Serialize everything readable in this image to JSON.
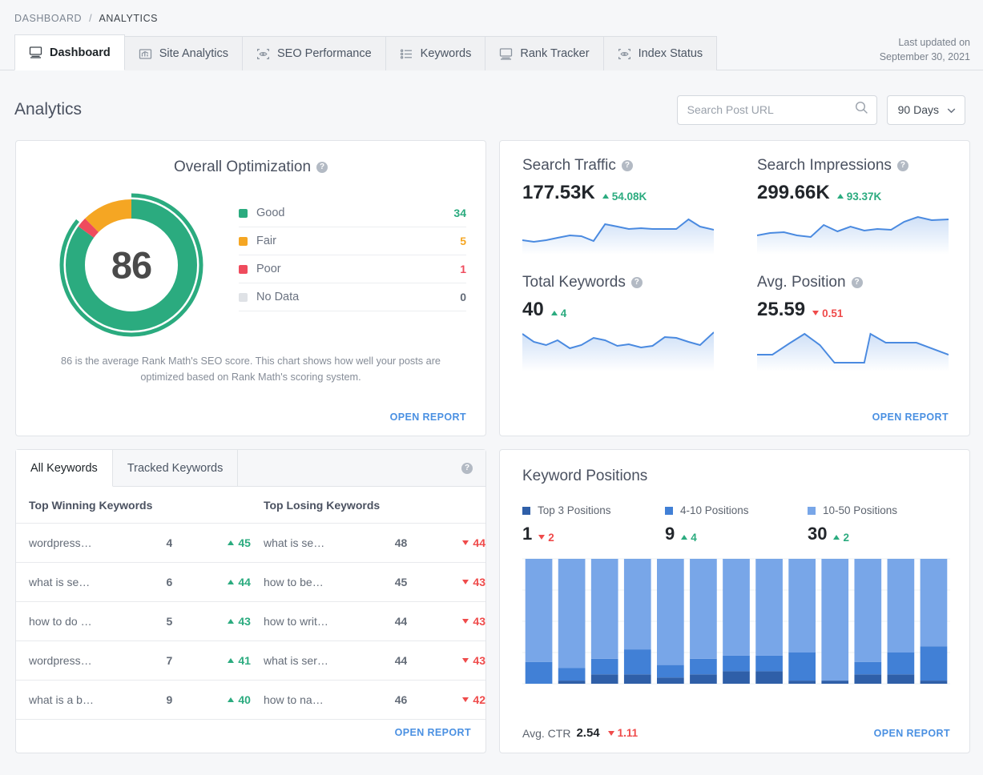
{
  "breadcrumb": {
    "parent": "DASHBOARD",
    "separator": "/",
    "current": "ANALYTICS"
  },
  "tabs": [
    {
      "label": "Dashboard",
      "icon": "monitor-icon",
      "active": true
    },
    {
      "label": "Site Analytics",
      "icon": "bar-chart-icon",
      "active": false
    },
    {
      "label": "SEO Performance",
      "icon": "eye-scan-icon",
      "active": false
    },
    {
      "label": "Keywords",
      "icon": "list-icon",
      "active": false
    },
    {
      "label": "Rank Tracker",
      "icon": "monitor-icon",
      "active": false
    },
    {
      "label": "Index Status",
      "icon": "eye-scan-icon",
      "active": false
    }
  ],
  "last_updated": {
    "label": "Last updated on",
    "date": "September 30, 2021"
  },
  "page_title": "Analytics",
  "search": {
    "placeholder": "Search Post URL",
    "value": "",
    "icon": "search-icon"
  },
  "range_select": {
    "value": "90 Days",
    "icon": "chevron-down-icon"
  },
  "optimization": {
    "title": "Overall Optimization",
    "help": "?",
    "score": "86",
    "legend": [
      {
        "label": "Good",
        "value": "34",
        "color": "#2bab7f"
      },
      {
        "label": "Fair",
        "value": "5",
        "color": "#f5a623"
      },
      {
        "label": "Poor",
        "value": "1",
        "color": "#ef4b5d"
      },
      {
        "label": "No Data",
        "value": "0",
        "color": "#dfe2e6"
      }
    ],
    "description": "86 is the average Rank Math's SEO score. This chart shows how well your posts are optimized based on Rank Math's scoring system.",
    "open_report": "OPEN REPORT"
  },
  "metrics": [
    {
      "title": "Search Traffic",
      "value": "177.53K",
      "delta": "54.08K",
      "dir": "up"
    },
    {
      "title": "Search Impressions",
      "value": "299.66K",
      "delta": "93.37K",
      "dir": "up"
    },
    {
      "title": "Total Keywords",
      "value": "40",
      "delta": "4",
      "dir": "up"
    },
    {
      "title": "Avg. Position",
      "value": "25.59",
      "delta": "0.51",
      "dir": "down"
    }
  ],
  "metrics_open_report": "OPEN REPORT",
  "keywords_panel": {
    "tabs": [
      {
        "label": "All Keywords",
        "active": true
      },
      {
        "label": "Tracked Keywords",
        "active": false
      }
    ],
    "help": "?",
    "columns": [
      "Top Winning Keywords",
      "Top Losing Keywords"
    ],
    "winning": [
      {
        "keyword": "wordpress log in",
        "position": "4",
        "change": "45",
        "dir": "up"
      },
      {
        "keyword": "what is seo service",
        "position": "6",
        "change": "44",
        "dir": "up"
      },
      {
        "keyword": "how to do seo for website",
        "position": "5",
        "change": "43",
        "dir": "up"
      },
      {
        "keyword": "wordpress pricing",
        "position": "7",
        "change": "41",
        "dir": "up"
      },
      {
        "keyword": "what is a backlink seo",
        "position": "9",
        "change": "40",
        "dir": "up"
      }
    ],
    "losing": [
      {
        "keyword": "what is seo and how does…",
        "position": "48",
        "change": "44",
        "dir": "down"
      },
      {
        "keyword": "how to become seo",
        "position": "45",
        "change": "43",
        "dir": "down"
      },
      {
        "keyword": "how to write a meta descr…",
        "position": "44",
        "change": "43",
        "dir": "down"
      },
      {
        "keyword": "what is serp in seo",
        "position": "44",
        "change": "43",
        "dir": "down"
      },
      {
        "keyword": "how to name images for s…",
        "position": "46",
        "change": "42",
        "dir": "down"
      }
    ],
    "open_report": "OPEN REPORT"
  },
  "keyword_positions": {
    "title": "Keyword Positions",
    "legend": [
      {
        "label": "Top 3 Positions",
        "value": "1",
        "delta": "2",
        "dir": "down",
        "color": "#2f5fa8"
      },
      {
        "label": "4-10 Positions",
        "value": "9",
        "delta": "4",
        "dir": "up",
        "color": "#4180d6"
      },
      {
        "label": "10-50 Positions",
        "value": "30",
        "delta": "2",
        "dir": "up",
        "color": "#78a6e8"
      }
    ],
    "ctr_label": "Avg. CTR",
    "ctr_value": "2.54",
    "ctr_delta": "1.11",
    "ctr_dir": "down",
    "open_report": "OPEN REPORT"
  },
  "chart_data": [
    {
      "type": "bar",
      "title": "Keyword Positions",
      "subtype": "stacked-column",
      "series": [
        {
          "name": "Top 3 Positions",
          "color": "#2f5fa8",
          "values": [
            0,
            1,
            3,
            3,
            2,
            3,
            4,
            4,
            1,
            1,
            3,
            3,
            1
          ]
        },
        {
          "name": "4-10 Positions",
          "color": "#4180d6",
          "values": [
            7,
            4,
            5,
            8,
            4,
            5,
            5,
            5,
            9,
            0,
            4,
            7,
            11
          ]
        },
        {
          "name": "10-50 Positions",
          "color": "#78a6e8",
          "values": [
            33,
            35,
            32,
            29,
            34,
            32,
            31,
            31,
            30,
            39,
            33,
            30,
            28
          ]
        }
      ],
      "categories": [
        "1",
        "2",
        "3",
        "4",
        "5",
        "6",
        "7",
        "8",
        "9",
        "10",
        "11",
        "12",
        "13"
      ],
      "ylim": [
        0,
        40
      ],
      "grid": true,
      "legend_position": "top"
    },
    {
      "type": "line",
      "title": "Search Traffic",
      "subtype": "sparkline-area",
      "color": "#4a8ae0",
      "values": [
        20,
        17,
        22,
        26,
        29,
        28,
        20,
        43,
        40,
        36,
        37,
        36,
        36,
        36,
        48,
        38,
        34
      ],
      "ylim": [
        0,
        60
      ]
    },
    {
      "type": "line",
      "title": "Search Impressions",
      "subtype": "sparkline-area",
      "color": "#4a8ae0",
      "values": [
        26,
        30,
        31,
        26,
        24,
        41,
        33,
        40,
        34,
        36,
        35,
        46,
        52,
        48,
        49
      ],
      "ylim": [
        0,
        60
      ]
    },
    {
      "type": "line",
      "title": "Total Keywords",
      "subtype": "sparkline-area",
      "color": "#4a8ae0",
      "values": [
        50,
        40,
        36,
        41,
        32,
        36,
        44,
        41,
        35,
        37,
        34,
        35,
        45,
        44,
        40,
        36,
        52
      ],
      "ylim": [
        0,
        60
      ]
    },
    {
      "type": "line",
      "title": "Avg. Position",
      "subtype": "sparkline-area",
      "color": "#4a8ae0",
      "values": [
        22,
        22,
        22,
        35,
        48,
        30,
        12,
        12,
        12,
        12,
        48,
        37,
        37,
        37,
        37,
        30,
        22
      ],
      "ylim": [
        0,
        60
      ]
    }
  ]
}
